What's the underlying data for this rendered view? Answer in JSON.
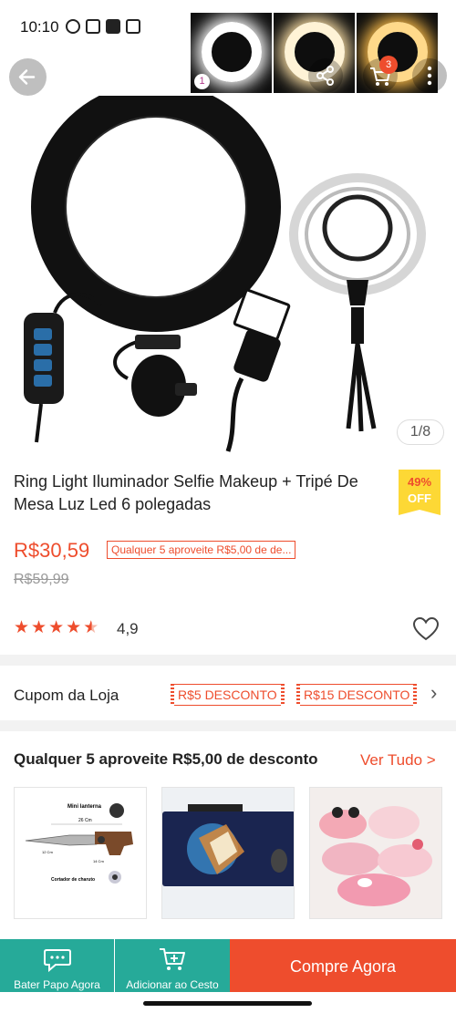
{
  "status": {
    "time": "10:10",
    "battery": "100"
  },
  "gallery": {
    "thumb_index": "1",
    "counter": "1/8"
  },
  "header": {
    "cart_count": "3"
  },
  "product": {
    "title": "Ring Light Iluminador Selfie Makeup + Tripé De Mesa Luz Led 6 polegadas",
    "discount_percent": "49%",
    "discount_off": "OFF",
    "price": "R$30,59",
    "promo": "Qualquer 5 aproveite R$5,00 de de...",
    "old_price": "R$59,99",
    "rating": "4,9",
    "rating_value": 4.5
  },
  "coupons": {
    "label": "Cupom da Loja",
    "items": [
      "R$5 DESCONTO",
      "R$15 DESCONTO"
    ]
  },
  "bundle": {
    "title": "Qualquer 5 aproveite R$5,00 de desconto",
    "see_all": "Ver Tudo >",
    "cards": [
      {
        "caption": "Mini lanterna",
        "dim1": "26 Cm",
        "dim2": "12 Cm",
        "dim3": "14 Cm",
        "caption2": "Cortador de charuto"
      }
    ]
  },
  "bottom_bar": {
    "chat_label": "Bater Papo Agora",
    "add_cart_label": "Adicionar ao Cesto",
    "buy_label": "Compre Agora"
  },
  "colors": {
    "accent": "#ee4d2d",
    "teal": "#26aa99",
    "badge": "#fdd835"
  }
}
